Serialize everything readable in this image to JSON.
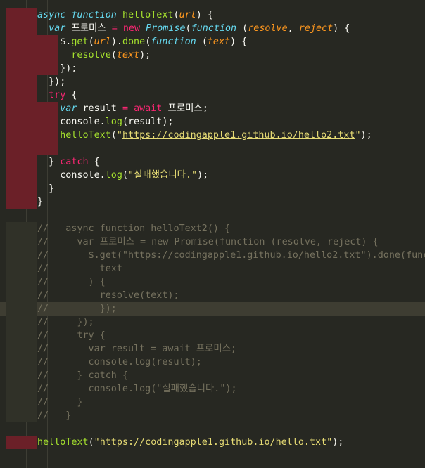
{
  "editor": {
    "colors": {
      "background": "#272822",
      "active_line": "#3e3d32",
      "error_gutter": "#6b2028",
      "keyword": "#f92672",
      "storage": "#66d9ef",
      "function": "#a6e22e",
      "parameter": "#fd971f",
      "string": "#e6db74",
      "comment": "#75715e",
      "text": "#f8f8f2"
    },
    "lines": [
      {
        "mark": "err",
        "tokens": [
          [
            "t-sto",
            "async"
          ],
          [
            "t-ws",
            " "
          ],
          [
            "t-sto",
            "function"
          ],
          [
            "t-ws",
            " "
          ],
          [
            "t-fn",
            "helloText"
          ],
          [
            "t-pun",
            "("
          ],
          [
            "t-par",
            "url"
          ],
          [
            "t-pun",
            ") {"
          ]
        ]
      },
      {
        "mark": "err",
        "tokens": [
          [
            "t-ws",
            "  "
          ],
          [
            "t-sto",
            "var"
          ],
          [
            "t-ws",
            " "
          ],
          [
            "t-txt",
            "프로미스"
          ],
          [
            "t-ws",
            " "
          ],
          [
            "t-op",
            "="
          ],
          [
            "t-ws",
            " "
          ],
          [
            "t-kw",
            "new"
          ],
          [
            "t-ws",
            " "
          ],
          [
            "t-cls",
            "Promise"
          ],
          [
            "t-pun",
            "("
          ],
          [
            "t-sto",
            "function"
          ],
          [
            "t-ws",
            " "
          ],
          [
            "t-pun",
            "("
          ],
          [
            "t-par",
            "resolve"
          ],
          [
            "t-pun",
            ", "
          ],
          [
            "t-par",
            "reject"
          ],
          [
            "t-pun",
            ") {"
          ]
        ]
      },
      {
        "mark": "err",
        "wide": true,
        "tokens": [
          [
            "t-ws",
            "    "
          ],
          [
            "t-txt",
            "$."
          ],
          [
            "t-fn",
            "get"
          ],
          [
            "t-pun",
            "("
          ],
          [
            "t-par",
            "url"
          ],
          [
            "t-pun",
            ")."
          ],
          [
            "t-fn",
            "done"
          ],
          [
            "t-pun",
            "("
          ],
          [
            "t-sto",
            "function"
          ],
          [
            "t-ws",
            " "
          ],
          [
            "t-pun",
            "("
          ],
          [
            "t-par",
            "text"
          ],
          [
            "t-pun",
            ") {"
          ]
        ]
      },
      {
        "mark": "err",
        "wide": true,
        "tokens": [
          [
            "t-ws",
            "      "
          ],
          [
            "t-fn",
            "resolve"
          ],
          [
            "t-pun",
            "("
          ],
          [
            "t-par",
            "text"
          ],
          [
            "t-pun",
            ");"
          ]
        ]
      },
      {
        "mark": "err",
        "wide": true,
        "tokens": [
          [
            "t-ws",
            "    "
          ],
          [
            "t-pun",
            "});"
          ]
        ]
      },
      {
        "mark": "err",
        "tokens": [
          [
            "t-ws",
            "  "
          ],
          [
            "t-pun",
            "});"
          ]
        ]
      },
      {
        "mark": "err",
        "tokens": [
          [
            "t-ws",
            "  "
          ],
          [
            "t-kw",
            "try"
          ],
          [
            "t-pun",
            " {"
          ]
        ]
      },
      {
        "mark": "err",
        "wide": true,
        "tokens": [
          [
            "t-ws",
            "    "
          ],
          [
            "t-sto",
            "var"
          ],
          [
            "t-ws",
            " "
          ],
          [
            "t-txt",
            "result"
          ],
          [
            "t-ws",
            " "
          ],
          [
            "t-op",
            "="
          ],
          [
            "t-ws",
            " "
          ],
          [
            "t-kw",
            "await"
          ],
          [
            "t-ws",
            " "
          ],
          [
            "t-txt",
            "프로미스"
          ],
          [
            "t-pun",
            ";"
          ]
        ]
      },
      {
        "mark": "err",
        "wide": true,
        "tokens": [
          [
            "t-ws",
            "    "
          ],
          [
            "t-txt",
            "console."
          ],
          [
            "t-fn",
            "log"
          ],
          [
            "t-pun",
            "("
          ],
          [
            "t-txt",
            "result"
          ],
          [
            "t-pun",
            ");"
          ]
        ]
      },
      {
        "mark": "err",
        "wide": true,
        "tokens": [
          [
            "t-ws",
            "    "
          ],
          [
            "t-fn",
            "helloText"
          ],
          [
            "t-pun",
            "("
          ],
          [
            "t-str",
            "\""
          ],
          [
            "t-url",
            "https://codingapple1.github.io/hello2.txt"
          ],
          [
            "t-str",
            "\""
          ],
          [
            "t-pun",
            ");"
          ]
        ]
      },
      {
        "mark": "err",
        "wide": true,
        "tokens": []
      },
      {
        "mark": "err",
        "tokens": [
          [
            "t-ws",
            "  "
          ],
          [
            "t-pun",
            "} "
          ],
          [
            "t-kw",
            "catch"
          ],
          [
            "t-pun",
            " {"
          ]
        ]
      },
      {
        "mark": "err",
        "tokens": [
          [
            "t-ws",
            "    "
          ],
          [
            "t-txt",
            "console."
          ],
          [
            "t-fn",
            "log"
          ],
          [
            "t-pun",
            "("
          ],
          [
            "t-str",
            "\"실패했습니다.\""
          ],
          [
            "t-pun",
            ");"
          ]
        ]
      },
      {
        "mark": "err",
        "tokens": [
          [
            "t-ws",
            "  "
          ],
          [
            "t-pun",
            "}"
          ]
        ]
      },
      {
        "mark": "err",
        "tokens": [
          [
            "t-pun",
            "}"
          ]
        ]
      },
      {
        "mark": "none",
        "tokens": []
      },
      {
        "mark": "diff",
        "tokens": [
          [
            "t-cmt",
            "//   async function helloText2() {"
          ]
        ]
      },
      {
        "mark": "diff",
        "tokens": [
          [
            "t-cmt",
            "//     var 프로미스 = new Promise(function (resolve, reject) {"
          ]
        ]
      },
      {
        "mark": "diff",
        "tokens": [
          [
            "t-cmt",
            "//       $.get(\""
          ],
          [
            "t-cmtu",
            "https://codingapple1.github.io/hello2.txt"
          ],
          [
            "t-cmt",
            "\").done(function"
          ]
        ]
      },
      {
        "mark": "diff",
        "tokens": [
          [
            "t-cmt",
            "//         text"
          ]
        ]
      },
      {
        "mark": "diff",
        "tokens": [
          [
            "t-cmt",
            "//       ) {"
          ]
        ]
      },
      {
        "mark": "diff",
        "tokens": [
          [
            "t-cmt",
            "//         resolve(text);"
          ]
        ]
      },
      {
        "mark": "diff",
        "active": true,
        "tokens": [
          [
            "t-cmt",
            "//         });"
          ]
        ]
      },
      {
        "mark": "diff",
        "tokens": [
          [
            "t-cmt",
            "//     });"
          ]
        ]
      },
      {
        "mark": "diff",
        "tokens": [
          [
            "t-cmt",
            "//     try {"
          ]
        ]
      },
      {
        "mark": "diff",
        "tokens": [
          [
            "t-cmt",
            "//       var result = await 프로미스;"
          ]
        ]
      },
      {
        "mark": "diff",
        "tokens": [
          [
            "t-cmt",
            "//       console.log(result);"
          ]
        ]
      },
      {
        "mark": "diff",
        "tokens": [
          [
            "t-cmt",
            "//     } catch {"
          ]
        ]
      },
      {
        "mark": "diff",
        "tokens": [
          [
            "t-cmt",
            "//       console.log(\"실패했습니다.\");"
          ]
        ]
      },
      {
        "mark": "diff",
        "tokens": [
          [
            "t-cmt",
            "//     }"
          ]
        ]
      },
      {
        "mark": "diff",
        "tokens": [
          [
            "t-cmt",
            "//   }"
          ]
        ]
      },
      {
        "mark": "none",
        "tokens": []
      },
      {
        "mark": "err",
        "tokens": [
          [
            "t-fn",
            "helloText"
          ],
          [
            "t-pun",
            "("
          ],
          [
            "t-str",
            "\""
          ],
          [
            "t-url",
            "https://codingapple1.github.io/hello.txt"
          ],
          [
            "t-str",
            "\""
          ],
          [
            "t-pun",
            ");"
          ]
        ]
      }
    ]
  }
}
